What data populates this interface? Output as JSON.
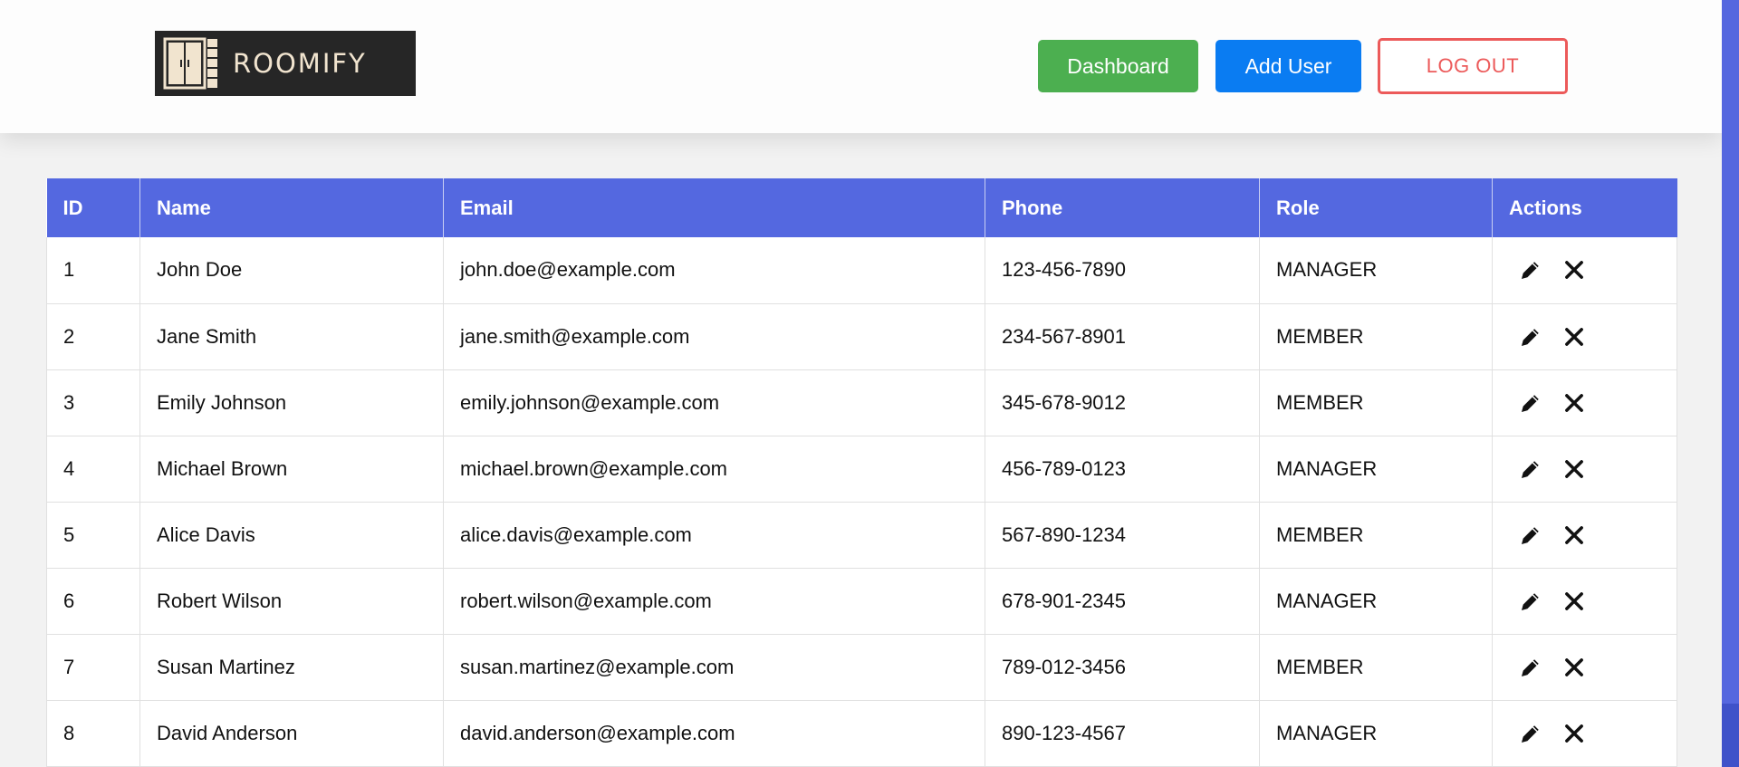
{
  "header": {
    "logo_text": "ROOMIFY",
    "buttons": {
      "dashboard": "Dashboard",
      "add_user": "Add User",
      "logout": "LOG OUT"
    }
  },
  "table": {
    "columns": [
      "ID",
      "Name",
      "Email",
      "Phone",
      "Role",
      "Actions"
    ],
    "rows": [
      {
        "id": "1",
        "name": "John Doe",
        "email": "john.doe@example.com",
        "phone": "123-456-7890",
        "role": "MANAGER"
      },
      {
        "id": "2",
        "name": "Jane Smith",
        "email": "jane.smith@example.com",
        "phone": "234-567-8901",
        "role": "MEMBER"
      },
      {
        "id": "3",
        "name": "Emily Johnson",
        "email": "emily.johnson@example.com",
        "phone": "345-678-9012",
        "role": "MEMBER"
      },
      {
        "id": "4",
        "name": "Michael Brown",
        "email": "michael.brown@example.com",
        "phone": "456-789-0123",
        "role": "MANAGER"
      },
      {
        "id": "5",
        "name": "Alice Davis",
        "email": "alice.davis@example.com",
        "phone": "567-890-1234",
        "role": "MEMBER"
      },
      {
        "id": "6",
        "name": "Robert Wilson",
        "email": "robert.wilson@example.com",
        "phone": "678-901-2345",
        "role": "MANAGER"
      },
      {
        "id": "7",
        "name": "Susan Martinez",
        "email": "susan.martinez@example.com",
        "phone": "789-012-3456",
        "role": "MEMBER"
      },
      {
        "id": "8",
        "name": "David Anderson",
        "email": "david.anderson@example.com",
        "phone": "890-123-4567",
        "role": "MANAGER"
      }
    ],
    "action_icons": [
      "pencil-icon",
      "close-icon"
    ]
  },
  "colors": {
    "header_row": "#5468e0",
    "dashboard_button": "#4caf50",
    "add_user_button": "#0a7cf2",
    "logout_border": "#ec5a5a",
    "scrollbar": "#5567df"
  }
}
